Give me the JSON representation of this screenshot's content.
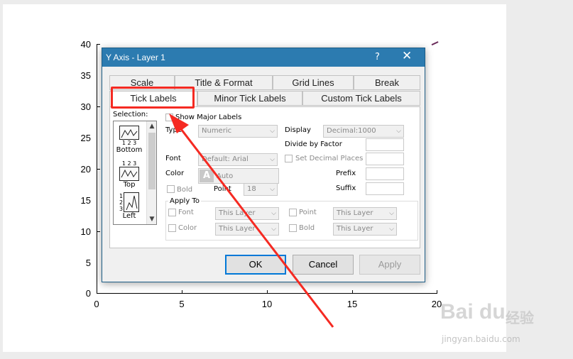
{
  "plot": {
    "y_ticks": [
      "40",
      "35",
      "30",
      "25",
      "20",
      "15",
      "10",
      "5",
      "0"
    ],
    "x_ticks": [
      "0",
      "5",
      "10",
      "15",
      "20"
    ]
  },
  "dialog": {
    "title": "Y Axis - Layer 1",
    "help_label": "?",
    "close_label": "✕",
    "tabs_row1": [
      "Scale",
      "Title & Format",
      "Grid Lines",
      "Break"
    ],
    "tabs_row2": [
      "Tick Labels",
      "Minor Tick Labels",
      "Custom Tick Labels"
    ],
    "active_tab": "Tick Labels",
    "selection": {
      "label": "Selection:",
      "items": [
        {
          "label": "Bottom",
          "nums": "1 2 3"
        },
        {
          "label": "Top",
          "nums": "1 2 3"
        },
        {
          "label": "Left",
          "nums": "1\n2\n3"
        }
      ]
    },
    "show_major_labels": {
      "label": "Show Major Labels",
      "checked": false
    },
    "type": {
      "label": "Type",
      "value": "Numeric"
    },
    "display": {
      "label": "Display",
      "value": "Decimal:1000"
    },
    "divide_by_factor": {
      "label": "Divide by Factor",
      "value": ""
    },
    "font": {
      "label": "Font",
      "value": "Default: Arial"
    },
    "set_decimal_places": {
      "label": "Set Decimal Places",
      "value": ""
    },
    "color": {
      "label": "Color",
      "value": "Auto",
      "swatch_letter": "A"
    },
    "prefix": {
      "label": "Prefix",
      "value": ""
    },
    "bold": {
      "label": "Bold"
    },
    "point": {
      "label": "Point",
      "value": "18"
    },
    "suffix": {
      "label": "Suffix",
      "value": ""
    },
    "apply_to": {
      "label": "Apply To",
      "font": {
        "label": "Font",
        "value": "This Layer"
      },
      "point": {
        "label": "Point",
        "value": "This Layer"
      },
      "color": {
        "label": "Color",
        "value": "This Layer"
      },
      "bold": {
        "label": "Bold",
        "value": "This Layer"
      }
    },
    "buttons": {
      "ok": "OK",
      "cancel": "Cancel",
      "apply": "Apply"
    }
  },
  "watermark": {
    "brand": "Bai du",
    "cn": "经验",
    "url": "jingyan.baidu.com"
  },
  "colors": {
    "titlebar": "#2c7bb0",
    "highlight": "#f52a22",
    "ok_border": "#0078d7"
  }
}
